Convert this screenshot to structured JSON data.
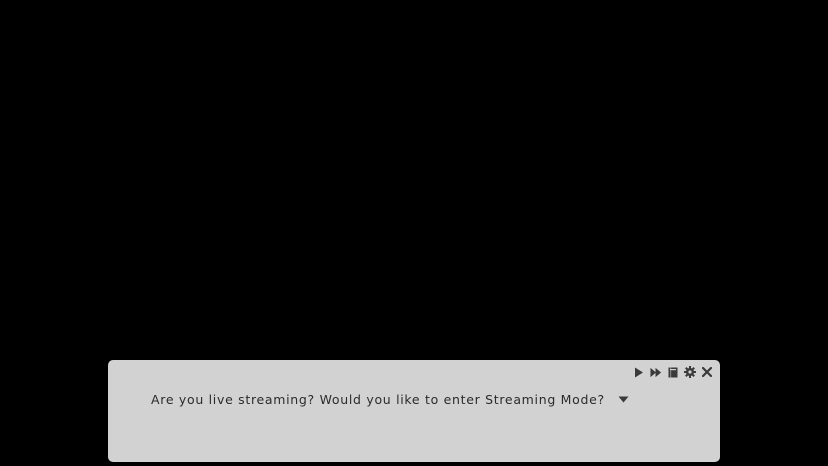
{
  "dialog": {
    "text": "Are you live streaming? Would you like to enter Streaming Mode?"
  },
  "controls": [
    {
      "name": "play-icon",
      "action": "auto"
    },
    {
      "name": "fast-forward-icon",
      "action": "skip"
    },
    {
      "name": "log-icon",
      "action": "log"
    },
    {
      "name": "gear-icon",
      "action": "settings"
    },
    {
      "name": "close-icon",
      "action": "close"
    }
  ],
  "advance_indicator": "chevron-down-icon",
  "colors": {
    "background": "#000000",
    "dialog_box": "#d2d2d2",
    "text": "#2b2b2b",
    "icon": "#3a3a3a"
  }
}
